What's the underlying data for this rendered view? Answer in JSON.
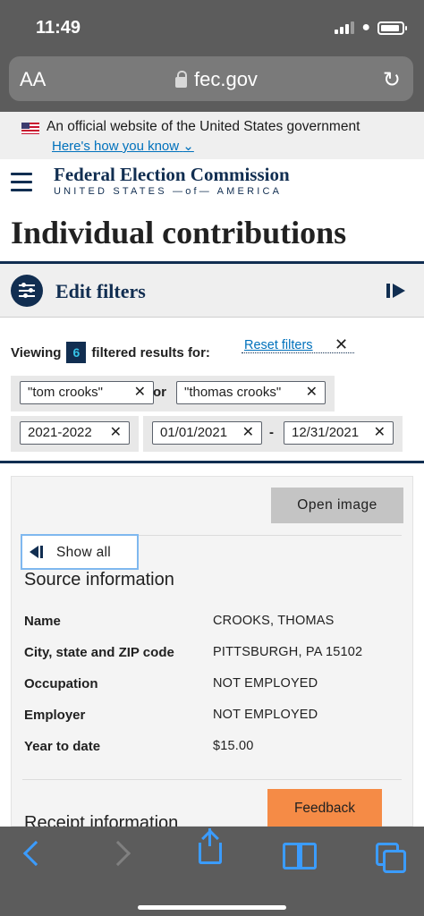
{
  "status": {
    "time": "11:49"
  },
  "browser": {
    "text_size": "AA",
    "url": "fec.gov"
  },
  "banner": {
    "official_text": "An official website of the United States government",
    "how_link": "Here's how you know"
  },
  "brand": {
    "title": "Federal Election Commission",
    "subtitle": "UNITED STATES —of— AMERICA"
  },
  "page": {
    "title": "Individual contributions"
  },
  "filters": {
    "toggle_label": "Edit filters",
    "viewing_prefix": "Viewing",
    "count": "6",
    "viewing_suffix": "filtered results for:",
    "reset_label": "Reset filters",
    "close_glyph": "✕",
    "name_tags": [
      "\"tom crooks\"",
      "\"thomas crooks\""
    ],
    "or_label": "or",
    "cycle_tag": "2021-2022",
    "date_from": "01/01/2021",
    "date_sep": "-",
    "date_to": "12/31/2021"
  },
  "detail": {
    "open_image_label": "Open image",
    "show_all_label": "Show all",
    "source_title": "Source information",
    "fields": [
      {
        "label": "Name",
        "value": "CROOKS, THOMAS"
      },
      {
        "label": "City, state and ZIP code",
        "value": "PITTSBURGH, PA 15102"
      },
      {
        "label": "Occupation",
        "value": "NOT EMPLOYED"
      },
      {
        "label": "Employer",
        "value": "NOT EMPLOYED"
      },
      {
        "label": "Year to date",
        "value": "$15.00"
      }
    ],
    "receipt_title": "Receipt information",
    "feedback_label": "Feedback"
  },
  "icons": {
    "reload": "reload-icon",
    "lock": "lock-icon",
    "menu": "hamburger-menu-icon",
    "filters": "sliders-icon",
    "collapse": "collapse-panel-icon"
  },
  "colors": {
    "navy": "#112e51",
    "link": "#0071bc",
    "feedback": "#f58b46",
    "toolbar_blue": "#3b9cff"
  }
}
